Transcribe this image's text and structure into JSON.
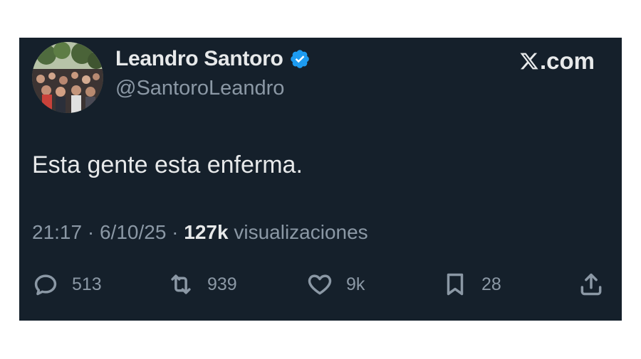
{
  "tweet": {
    "display_name": "Leandro Santoro",
    "handle": "@SantoroLeandro",
    "brand": ".com",
    "text": "Esta gente esta enferma.",
    "time": "21:17",
    "date": "6/10/25",
    "views_count": "127k",
    "views_label": "visualizaciones",
    "separator": "·"
  },
  "actions": {
    "replies": "513",
    "reposts": "939",
    "likes": "9k",
    "bookmarks": "28"
  },
  "icons": {
    "verified": "verified-badge-icon",
    "reply": "speech-bubble-icon",
    "repost": "repost-arrows-icon",
    "like": "heart-icon",
    "bookmark": "bookmark-icon",
    "share": "share-upload-icon",
    "brand": "x-logo-icon"
  },
  "colors": {
    "card_bg": "#15202b",
    "text_primary": "#e7e9ea",
    "text_secondary": "#8b98a5",
    "verified_blue": "#1d9bf0"
  }
}
